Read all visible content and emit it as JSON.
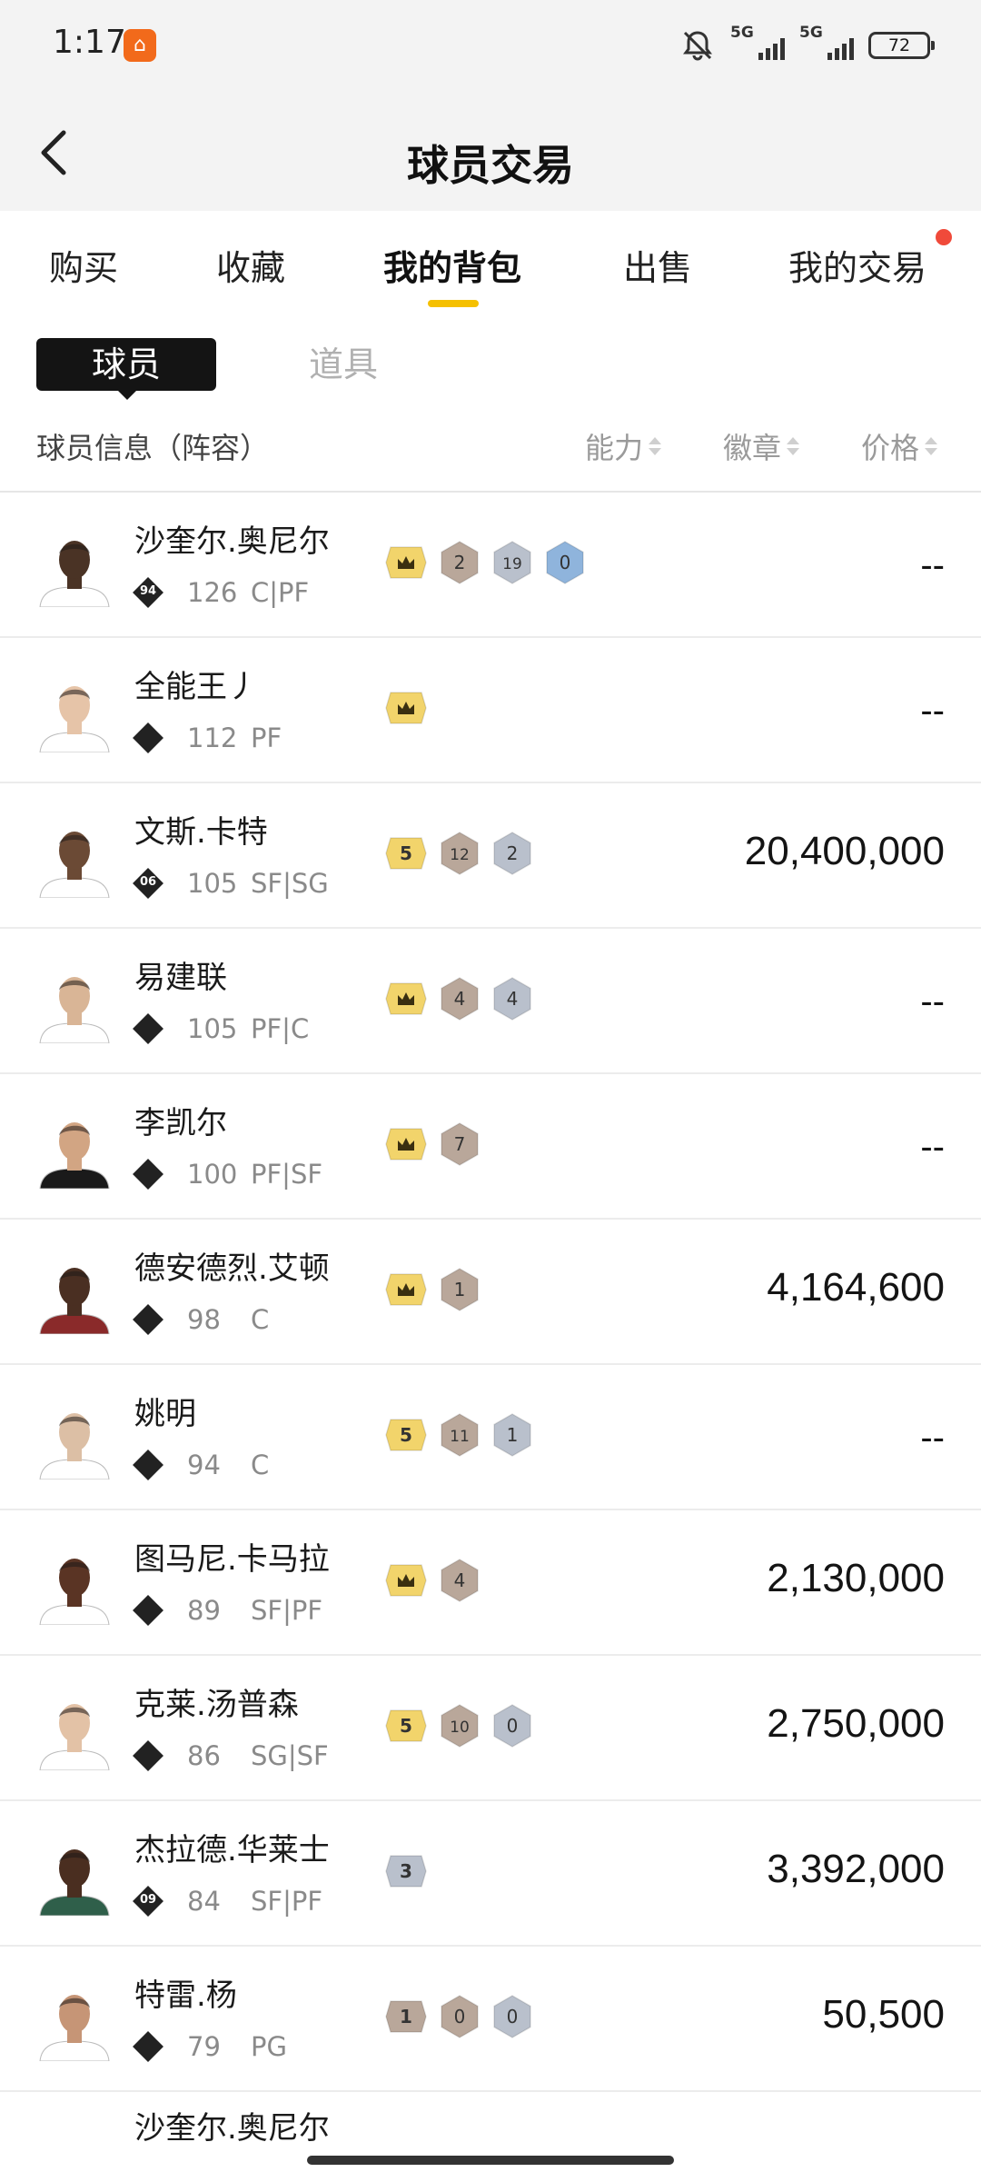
{
  "status_bar": {
    "time": "1:17",
    "signal_1": "5G",
    "signal_2": "5G",
    "battery": "72"
  },
  "header": {
    "title": "球员交易"
  },
  "tabs": [
    {
      "label": "购买"
    },
    {
      "label": "收藏"
    },
    {
      "label": "我的背包"
    },
    {
      "label": "出售"
    },
    {
      "label": "我的交易"
    }
  ],
  "subtabs": {
    "players": "球员",
    "items": "道具"
  },
  "table_header": {
    "info": "球员信息（阵容）",
    "ability": "能力",
    "badge": "徽章",
    "price": "价格"
  },
  "players": [
    {
      "name": "沙奎尔.奥尼尔",
      "tier": "94",
      "ovr": "126",
      "pos": "C|PF",
      "price": "--",
      "jersey": "#ffffff",
      "skin": "#4a3325",
      "badges": [
        {
          "t": "crown"
        },
        {
          "t": "bronze",
          "v": "2"
        },
        {
          "t": "silver",
          "v": "19"
        },
        {
          "t": "blue",
          "v": "0"
        }
      ]
    },
    {
      "name": "全能王丿",
      "tier": "",
      "ovr": "112",
      "pos": "PF",
      "price": "--",
      "jersey": "#ffffff",
      "skin": "#e6c4a8",
      "badges": [
        {
          "t": "crown"
        }
      ]
    },
    {
      "name": "文斯.卡特",
      "tier": "06",
      "ovr": "105",
      "pos": "SF|SG",
      "price": "20,400,000",
      "jersey": "#ffffff",
      "skin": "#6b4a35",
      "badges": [
        {
          "t": "gold",
          "v": "5"
        },
        {
          "t": "bronze",
          "v": "12"
        },
        {
          "t": "silver",
          "v": "2"
        }
      ]
    },
    {
      "name": "易建联",
      "tier": "",
      "ovr": "105",
      "pos": "PF|C",
      "price": "--",
      "jersey": "#ffffff",
      "skin": "#d9b596",
      "badges": [
        {
          "t": "crown"
        },
        {
          "t": "bronze",
          "v": "4"
        },
        {
          "t": "silver",
          "v": "4"
        }
      ]
    },
    {
      "name": "李凯尔",
      "tier": "",
      "ovr": "100",
      "pos": "PF|SF",
      "price": "--",
      "jersey": "#1a1a1a",
      "skin": "#d2a583",
      "badges": [
        {
          "t": "crown"
        },
        {
          "t": "bronze",
          "v": "7"
        }
      ]
    },
    {
      "name": "德安德烈.艾顿",
      "tier": "",
      "ovr": "98",
      "pos": "C",
      "price": "4,164,600",
      "jersey": "#8a2a2a",
      "skin": "#4a2f22",
      "badges": [
        {
          "t": "crown"
        },
        {
          "t": "bronze",
          "v": "1"
        }
      ]
    },
    {
      "name": "姚明",
      "tier": "",
      "ovr": "94",
      "pos": "C",
      "price": "--",
      "jersey": "#ffffff",
      "skin": "#dcbfa5",
      "badges": [
        {
          "t": "gold",
          "v": "5"
        },
        {
          "t": "bronze",
          "v": "11"
        },
        {
          "t": "silver",
          "v": "1"
        }
      ]
    },
    {
      "name": "图马尼.卡马拉",
      "tier": "",
      "ovr": "89",
      "pos": "SF|PF",
      "price": "2,130,000",
      "jersey": "#ffffff",
      "skin": "#5a3424",
      "badges": [
        {
          "t": "crown"
        },
        {
          "t": "bronze",
          "v": "4"
        }
      ]
    },
    {
      "name": "克莱.汤普森",
      "tier": "",
      "ovr": "86",
      "pos": "SG|SF",
      "price": "2,750,000",
      "jersey": "#ffffff",
      "skin": "#e3c2a6",
      "badges": [
        {
          "t": "gold",
          "v": "5"
        },
        {
          "t": "bronze",
          "v": "10"
        },
        {
          "t": "silver",
          "v": "0"
        }
      ]
    },
    {
      "name": "杰拉德.华莱士",
      "tier": "09",
      "ovr": "84",
      "pos": "SF|PF",
      "price": "3,392,000",
      "jersey": "#2f5f4a",
      "skin": "#4a2e20",
      "badges": [
        {
          "t": "silverplain",
          "v": "3"
        }
      ]
    },
    {
      "name": "特雷.杨",
      "tier": "",
      "ovr": "79",
      "pos": "PG",
      "price": "50,500",
      "jersey": "#ffffff",
      "skin": "#c69576",
      "badges": [
        {
          "t": "bronze",
          "v": "1"
        },
        {
          "t": "bronze",
          "v": "0"
        },
        {
          "t": "silver",
          "v": "0"
        }
      ]
    }
  ],
  "partial_row_name": "沙奎尔.奥尼尔",
  "tier_icons": [
    "diamond-94",
    "diamond-person",
    "diamond-06",
    "diamond-star",
    "diamond-star",
    "diamond-bars",
    "diamond-star",
    "diamond-bars",
    "diamond-bars",
    "diamond-09",
    "diamond-bars"
  ],
  "colors": {
    "accent": "#f5c000",
    "notification": "#f04a3a",
    "gold_badge": "#f2d46b",
    "bronze_badge": "#b9a79a",
    "silver_badge": "#b9c0cc",
    "blue_badge": "#8fb4dc"
  }
}
